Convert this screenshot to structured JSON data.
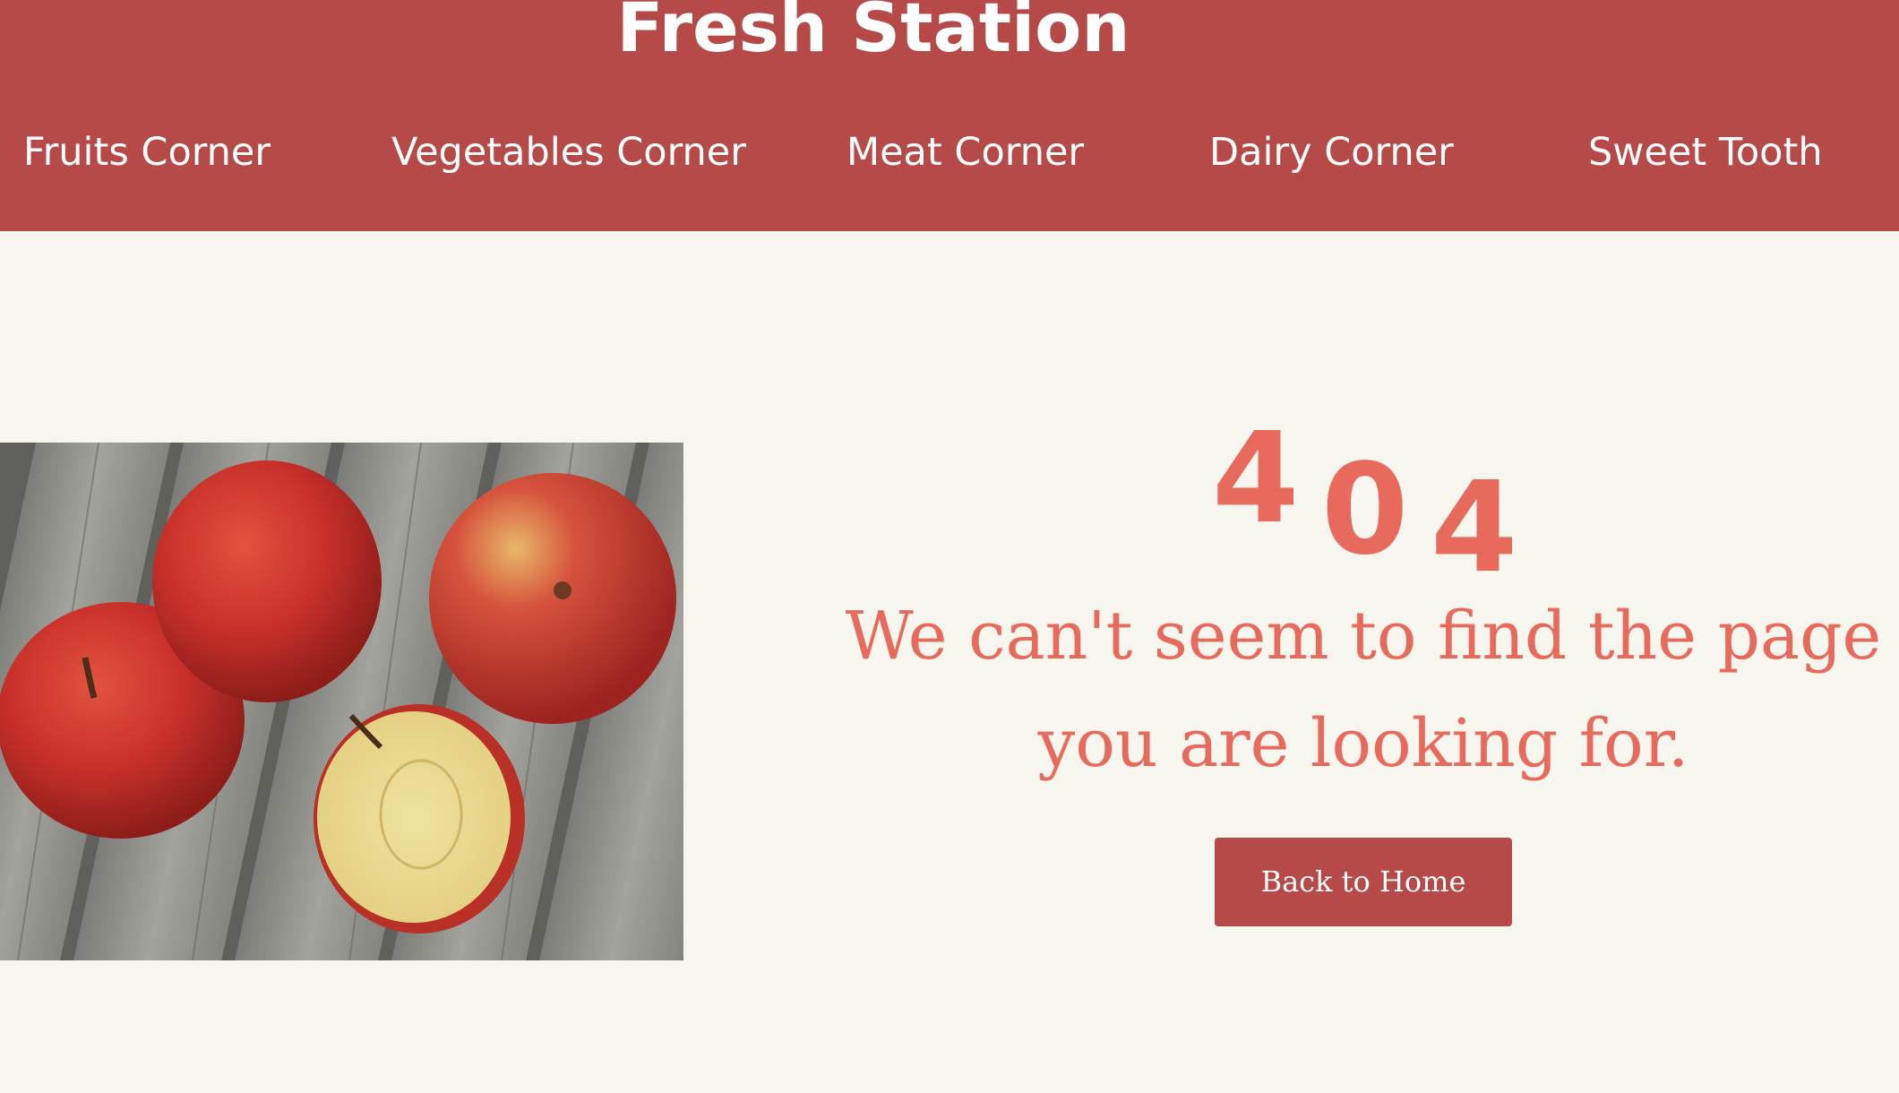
{
  "header": {
    "title": "Fresh Station",
    "nav": [
      {
        "label": "Fruits Corner"
      },
      {
        "label": "Vegetables Corner"
      },
      {
        "label": "Meat Corner"
      },
      {
        "label": "Dairy Corner"
      },
      {
        "label": "Sweet Tooth"
      }
    ]
  },
  "main": {
    "error_digits": [
      "4",
      "0",
      "4"
    ],
    "message": "We can't seem to find the page you are looking for.",
    "button_label": "Back to Home",
    "image": "apples-on-wooden-table-photo"
  },
  "colors": {
    "brand": "#b54a48",
    "accent": "#e86a5c",
    "background": "#f7f6ee",
    "text_on_brand": "#ffffff"
  }
}
